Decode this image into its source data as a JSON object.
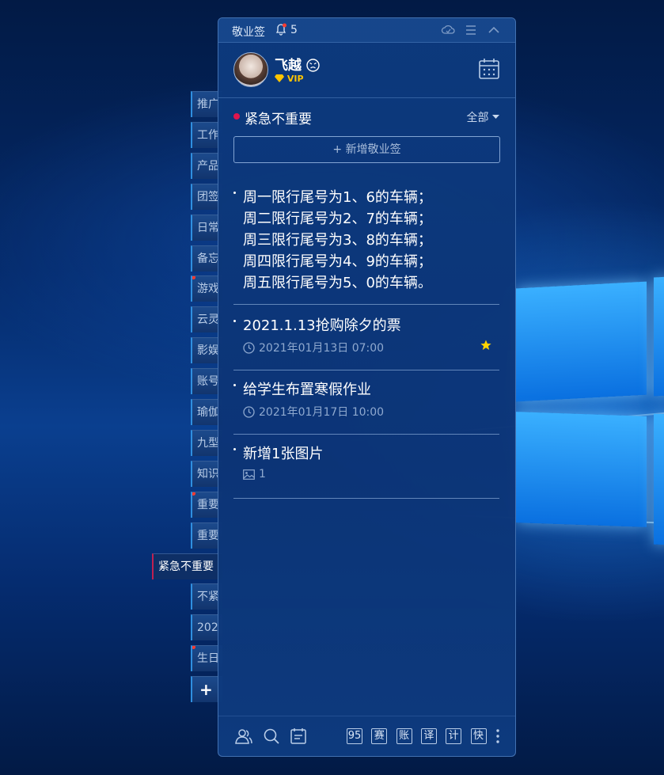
{
  "side_tabs": [
    {
      "label": "推广",
      "marker": false
    },
    {
      "label": "工作",
      "marker": false
    },
    {
      "label": "产品",
      "marker": false
    },
    {
      "label": "团签",
      "marker": false
    },
    {
      "label": "日常",
      "marker": false
    },
    {
      "label": "备忘",
      "marker": false
    },
    {
      "label": "游戏",
      "marker": true
    },
    {
      "label": "云灵",
      "marker": false
    },
    {
      "label": "影娱",
      "marker": false
    },
    {
      "label": "账号",
      "marker": false
    },
    {
      "label": "瑜伽",
      "marker": false
    },
    {
      "label": "九型",
      "marker": false
    },
    {
      "label": "知识",
      "marker": false
    },
    {
      "label": "重要",
      "marker": true
    },
    {
      "label": "重要",
      "marker": false
    },
    {
      "label": "紧急不重要",
      "marker": false,
      "active": true
    },
    {
      "label": "不紧",
      "marker": false
    },
    {
      "label": "202",
      "marker": false
    },
    {
      "label": "生日",
      "marker": true
    },
    {
      "label": "+",
      "marker": false
    }
  ],
  "titlebar": {
    "app_title": "敬业签",
    "notification_count": "5"
  },
  "profile": {
    "username": "飞越",
    "badge": "VIP"
  },
  "category": {
    "title": "紧急不重要",
    "filter_label": "全部",
    "color": "#e0154d"
  },
  "add_button_label": "+ 新增敬业签",
  "notes": [
    {
      "text": "周一限行尾号为1、6的车辆；\n周二限行尾号为2、7的车辆；\n周三限行尾号为3、8的车辆；\n周四限行尾号为4、9的车辆；\n周五限行尾号为5、0的车辆。",
      "meta": "",
      "meta_type": "none",
      "starred": false
    },
    {
      "text": "2021.1.13抢购除夕的票",
      "meta": "2021年01月13日 07:00",
      "meta_type": "clock",
      "starred": true
    },
    {
      "text": "给学生布置寒假作业",
      "meta": "2021年01月17日 10:00",
      "meta_type": "clock",
      "starred": false
    },
    {
      "text": "新增1张图片",
      "meta": "1",
      "meta_type": "image",
      "starred": false
    }
  ],
  "bottom_tools": [
    "95",
    "赛",
    "账",
    "译",
    "计",
    "快"
  ],
  "bottom_icons": [
    "contacts-icon",
    "search-icon",
    "notes-list-icon"
  ]
}
